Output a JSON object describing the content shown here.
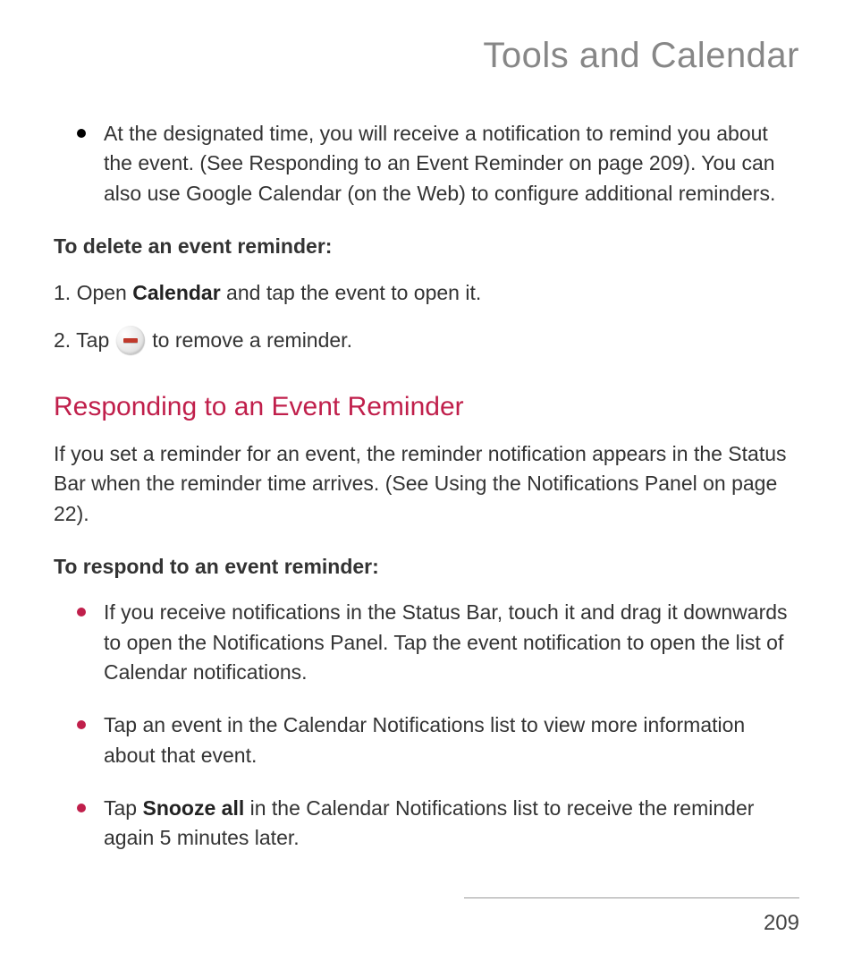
{
  "header": {
    "title": "Tools and Calendar"
  },
  "intro_bullet": {
    "text": "At the designated time, you will receive a notification to remind you about the event. (See Responding to an Event Reminder on page 209). You can also use Google Calendar (on the Web) to configure additional reminders."
  },
  "delete_section": {
    "heading": "To delete an event reminder:",
    "step1_pre": "1. Open ",
    "step1_bold": "Calendar",
    "step1_post": " and tap the event to open it.",
    "step2_pre": "2. Tap ",
    "step2_post": " to remove a reminder."
  },
  "responding": {
    "title": "Responding to an Event Reminder",
    "intro": "If you set a reminder for an event, the reminder notification appears in the Status Bar when the reminder time arrives. (See Using the Notifications Panel on page 22).",
    "subhead": "To respond to an event reminder:",
    "bullets": [
      "If you receive notifications in the Status Bar, touch it and drag it downwards to open the Notifications Panel. Tap the event notification to open the list of Calendar notifications.",
      "Tap an event in the Calendar Notifications list to view more information about that event."
    ],
    "bullet3_pre": "Tap ",
    "bullet3_bold": "Snooze all",
    "bullet3_post": " in the Calendar Notifications list to receive the reminder again 5 minutes later."
  },
  "page_number": "209"
}
